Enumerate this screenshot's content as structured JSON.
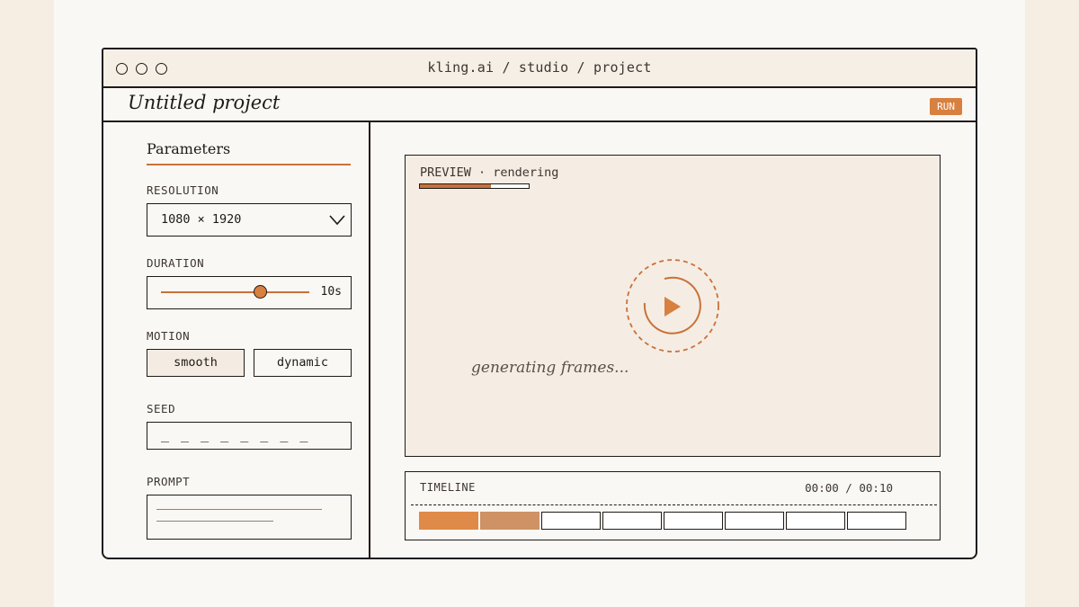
{
  "window": {
    "url": "kling.ai / studio / project"
  },
  "project": {
    "title": "Untitled project",
    "run_label": "RUN"
  },
  "sidebar": {
    "title": "Parameters",
    "resolution": {
      "label": "RESOLUTION",
      "value": "1080 × 1920"
    },
    "duration": {
      "label": "DURATION",
      "value": "10s",
      "slider_fraction": 0.67
    },
    "motion": {
      "label": "MOTION",
      "options": [
        "smooth",
        "dynamic"
      ],
      "selected": "smooth"
    },
    "seed": {
      "label": "SEED",
      "value": "_ _ _ _ _ _ _ _"
    },
    "prompt": {
      "label": "PROMPT"
    }
  },
  "preview": {
    "label": "PREVIEW · rendering",
    "progress": 0.65,
    "status_text": "generating frames..."
  },
  "timeline": {
    "label": "TIMELINE",
    "time": "00:00 / 00:10",
    "frames_total": 8,
    "frames_done": 2
  },
  "colors": {
    "accent": "#d8803f",
    "ink": "#1e1a17",
    "background": "#faf8f4",
    "panel": "#f5ede3"
  }
}
